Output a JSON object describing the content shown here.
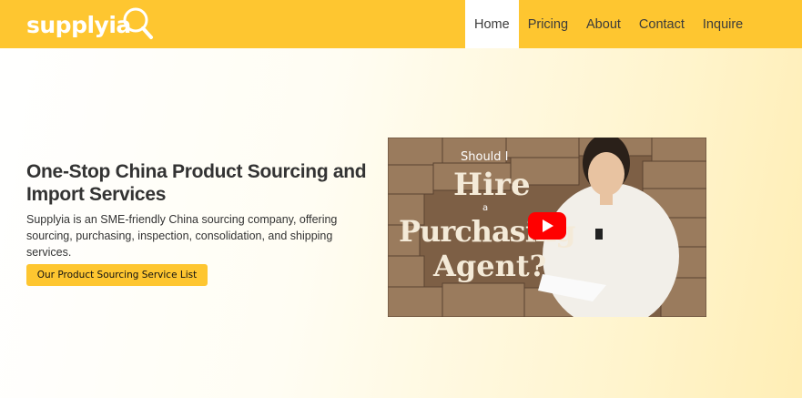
{
  "header": {
    "logo_text": "supplyia",
    "bg_color": "#fec630"
  },
  "nav": {
    "items": [
      {
        "label": "Home",
        "active": true
      },
      {
        "label": "Pricing"
      },
      {
        "label": "About"
      },
      {
        "label": "Contact"
      },
      {
        "label": "Inquire"
      }
    ]
  },
  "hero": {
    "title": "One-Stop China Product Sourcing and Import Services",
    "description": "Supplyia is an SME-friendly China sourcing company, offering sourcing, purchasing, inspection, consolidation, and shipping services.",
    "cta_label": "Our Product Sourcing Service List"
  },
  "video": {
    "line1": "Should I",
    "line2": "Hire",
    "line3": "a",
    "line4": "Purchasing",
    "line5": "Agent?",
    "play_icon": "youtube-play-icon",
    "play_color": "#ff0000"
  }
}
